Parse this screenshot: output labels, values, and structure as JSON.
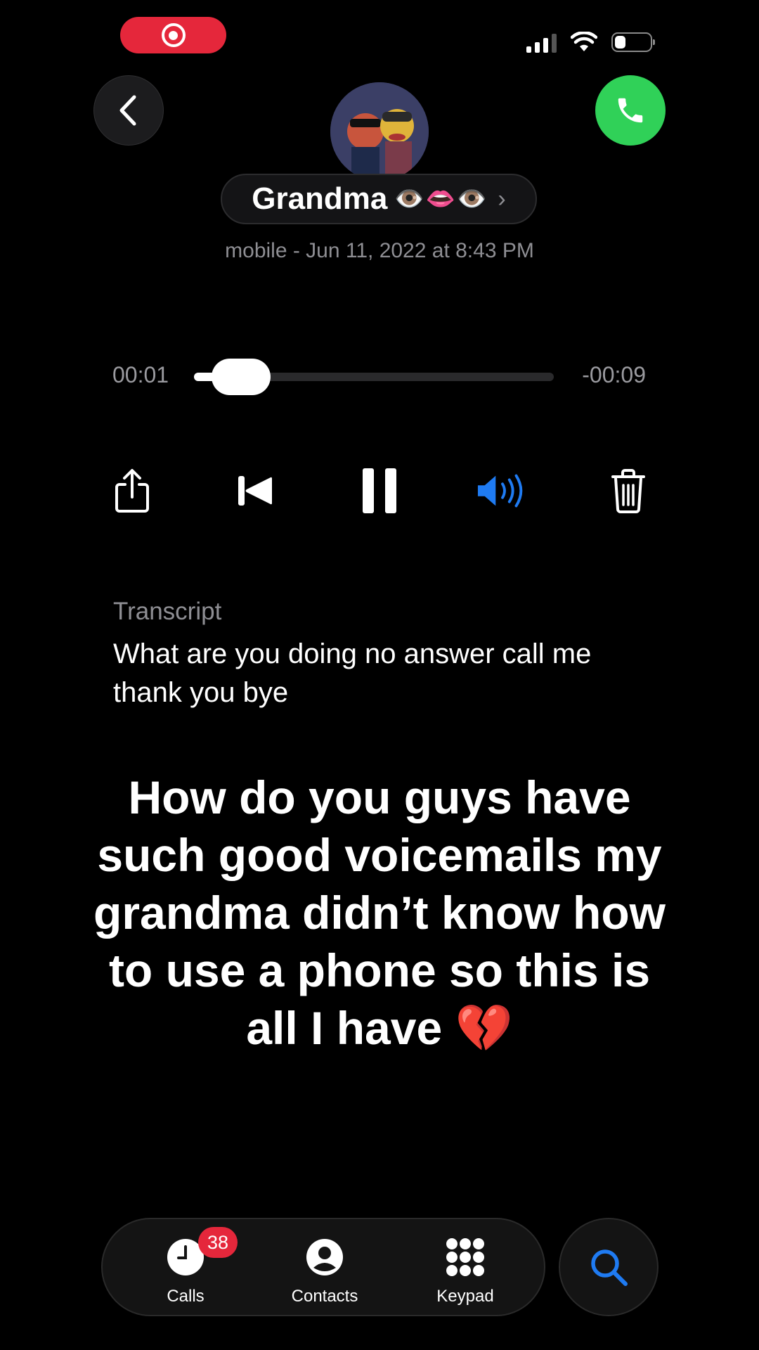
{
  "status_bar": {
    "recording_icon": "screen-record-icon",
    "signal_icon": "cellular-signal-icon",
    "wifi_icon": "wifi-icon",
    "battery_icon": "battery-icon",
    "recording_color": "#e5273b"
  },
  "header": {
    "back_icon": "chevron-left-icon",
    "call_icon": "phone-icon",
    "call_color": "#30d158",
    "contact_name": "Grandma",
    "contact_emoji": "👁️👄👁️",
    "contact_chevron": "›",
    "subtitle": "mobile - Jun 11, 2022 at 8:43 PM"
  },
  "player": {
    "elapsed": "00:01",
    "remaining": "-00:09",
    "progress_fraction": 0.1
  },
  "controls": {
    "share_icon": "share-icon",
    "restart_icon": "skip-back-icon",
    "pause_icon": "pause-icon",
    "speaker_icon": "speaker-icon",
    "delete_icon": "trash-icon",
    "speaker_color": "#1f7bf2"
  },
  "transcript": {
    "label": "Transcript",
    "text": "What are you doing no answer call me thank you bye"
  },
  "caption": "How do you guys have such good voicemails my grandma didn’t know how to use a phone so this is all I have 💔",
  "tabbar": {
    "tabs": [
      {
        "label": "Calls",
        "icon": "clock-icon"
      },
      {
        "label": "Contacts",
        "icon": "person-circle-icon"
      },
      {
        "label": "Keypad",
        "icon": "keypad-icon"
      }
    ],
    "calls_badge": "38",
    "search_icon": "search-icon",
    "search_color": "#1f7bf2"
  }
}
